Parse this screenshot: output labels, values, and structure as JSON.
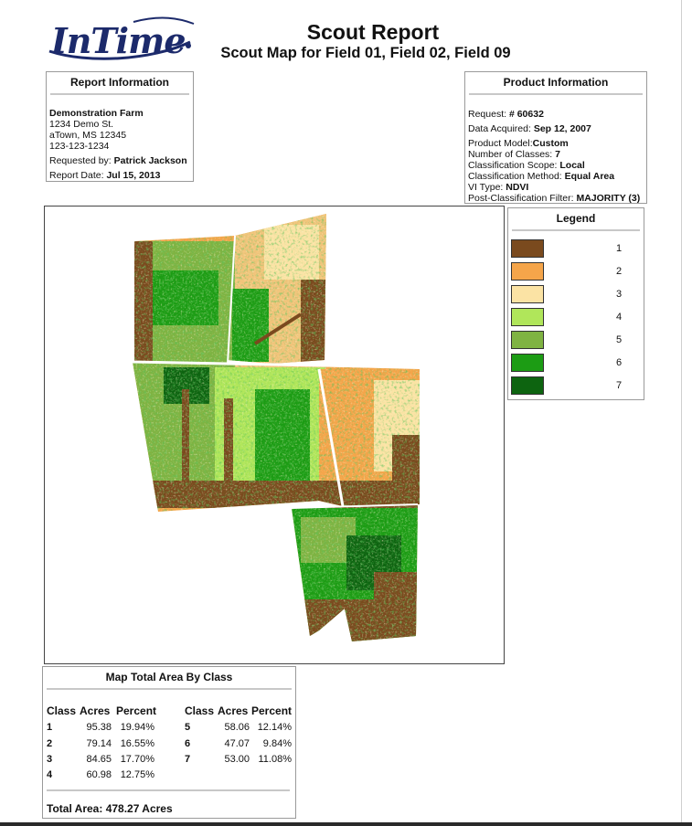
{
  "header": {
    "logo_text": "InTime",
    "title": "Scout Report",
    "subtitle": "Scout Map for Field 01, Field 02, Field 09"
  },
  "report_info": {
    "heading": "Report Information",
    "farm_name": "Demonstration Farm",
    "address_line1": "1234 Demo St.",
    "address_line2": "aTown, MS 12345",
    "phone": "123-123-1234",
    "requested_by_label": "Requested by:",
    "requested_by": "Patrick Jackson",
    "report_date_label": "Report Date:",
    "report_date": "Jul 15, 2013"
  },
  "product_info": {
    "heading": "Product Information",
    "request_label": "Request:",
    "request": "# 60632",
    "data_acquired_label": "Data Acquired:",
    "data_acquired": "Sep 12, 2007",
    "product_model_label": "Product Model:",
    "product_model": "Custom",
    "num_classes_label": "Number of Classes:",
    "num_classes": "7",
    "scope_label": "Classification Scope:",
    "scope": "Local",
    "method_label": "Classification Method:",
    "method": "Equal Area",
    "vi_type_label": "VI Type:",
    "vi_type": "NDVI",
    "filter_label": "Post-Classification Filter:",
    "filter": "MAJORITY (3)"
  },
  "legend": {
    "heading": "Legend",
    "items": [
      {
        "label": "1",
        "color": "#7a4a1e"
      },
      {
        "label": "2",
        "color": "#f5a54a"
      },
      {
        "label": "3",
        "color": "#fbe3a4"
      },
      {
        "label": "4",
        "color": "#b0e65a"
      },
      {
        "label": "5",
        "color": "#7fb342"
      },
      {
        "label": "6",
        "color": "#1c9c14"
      },
      {
        "label": "7",
        "color": "#0d6410"
      }
    ]
  },
  "area_table": {
    "heading": "Map Total Area By Class",
    "col_class": "Class",
    "col_acres": "Acres",
    "col_percent": "Percent",
    "left_rows": [
      {
        "cls": "1",
        "acres": "95.38",
        "percent": "19.94%"
      },
      {
        "cls": "2",
        "acres": "79.14",
        "percent": "16.55%"
      },
      {
        "cls": "3",
        "acres": "84.65",
        "percent": "17.70%"
      },
      {
        "cls": "4",
        "acres": "60.98",
        "percent": "12.75%"
      }
    ],
    "right_rows": [
      {
        "cls": "5",
        "acres": "58.06",
        "percent": "12.14%"
      },
      {
        "cls": "6",
        "acres": "47.07",
        "percent": "9.84%"
      },
      {
        "cls": "7",
        "acres": "53.00",
        "percent": "11.08%"
      }
    ],
    "total_label": "Total Area:",
    "total_value": "478.27 Acres"
  }
}
